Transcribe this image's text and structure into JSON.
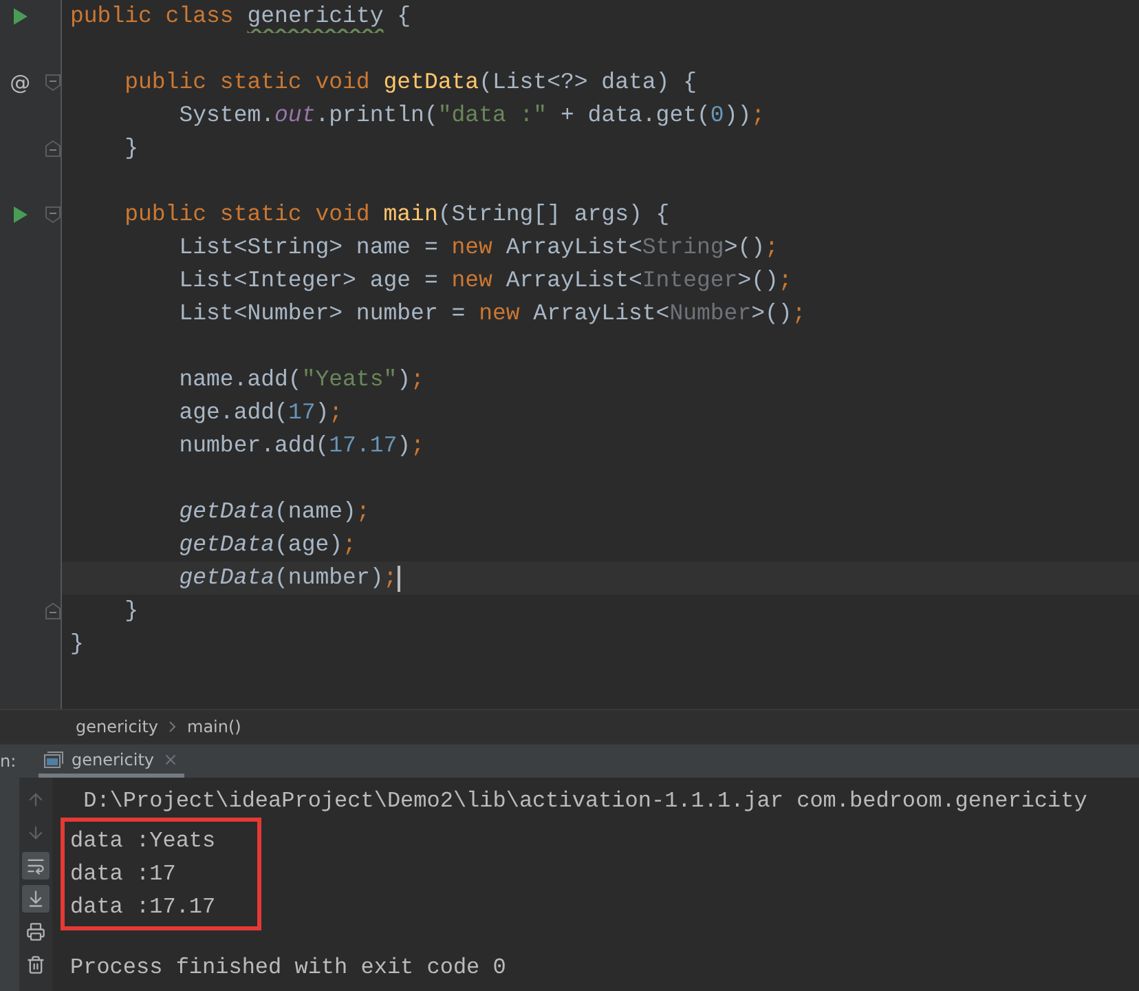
{
  "editor": {
    "lines": [
      {
        "marker": {
          "kind": "run"
        },
        "caret": false,
        "tokens": [
          {
            "kind": "kw",
            "text": "public class "
          },
          {
            "kind": "warn",
            "text": "genericity"
          },
          {
            "kind": "plain",
            "text": " {"
          }
        ]
      },
      {
        "caret": false
      },
      {
        "marker": {
          "kind": "override",
          "text": "@"
        },
        "fold": {
          "kind": "start"
        },
        "caret": false,
        "tokens": [
          {
            "kind": "kw",
            "text": "    public static void "
          },
          {
            "kind": "decl",
            "text": "getData"
          },
          {
            "kind": "plain",
            "text": "(List<?> data) {"
          }
        ]
      },
      {
        "caret": false,
        "tokens": [
          {
            "kind": "plain",
            "text": "        System."
          },
          {
            "kind": "field",
            "text": "out"
          },
          {
            "kind": "plain",
            "text": ".println("
          },
          {
            "kind": "str",
            "text": "\"data :\""
          },
          {
            "kind": "plain",
            "text": " + data.get("
          },
          {
            "kind": "num",
            "text": "0"
          },
          {
            "kind": "plain",
            "text": "))"
          },
          {
            "kind": "semi",
            "text": ";"
          }
        ]
      },
      {
        "fold": {
          "kind": "end"
        },
        "caret": false,
        "tokens": [
          {
            "kind": "plain",
            "text": "    }"
          }
        ]
      },
      {
        "caret": false
      },
      {
        "marker": {
          "kind": "run"
        },
        "fold": {
          "kind": "start"
        },
        "caret": false,
        "tokens": [
          {
            "kind": "kw",
            "text": "    public static void "
          },
          {
            "kind": "decl",
            "text": "main"
          },
          {
            "kind": "plain",
            "text": "(String[] args) {"
          }
        ]
      },
      {
        "caret": false,
        "tokens": [
          {
            "kind": "plain",
            "text": "        List<String> name = "
          },
          {
            "kind": "kw",
            "text": "new "
          },
          {
            "kind": "plain",
            "text": "ArrayList<"
          },
          {
            "kind": "hint",
            "text": "String"
          },
          {
            "kind": "plain",
            "text": ">()"
          },
          {
            "kind": "semi",
            "text": ";"
          }
        ]
      },
      {
        "caret": false,
        "tokens": [
          {
            "kind": "plain",
            "text": "        List<Integer> age = "
          },
          {
            "kind": "kw",
            "text": "new "
          },
          {
            "kind": "plain",
            "text": "ArrayList<"
          },
          {
            "kind": "hint",
            "text": "Integer"
          },
          {
            "kind": "plain",
            "text": ">()"
          },
          {
            "kind": "semi",
            "text": ";"
          }
        ]
      },
      {
        "caret": false,
        "tokens": [
          {
            "kind": "plain",
            "text": "        List<Number> number = "
          },
          {
            "kind": "kw",
            "text": "new "
          },
          {
            "kind": "plain",
            "text": "ArrayList<"
          },
          {
            "kind": "hint",
            "text": "Number"
          },
          {
            "kind": "plain",
            "text": ">()"
          },
          {
            "kind": "semi",
            "text": ";"
          }
        ]
      },
      {
        "caret": false
      },
      {
        "caret": false,
        "tokens": [
          {
            "kind": "plain",
            "text": "        name.add("
          },
          {
            "kind": "str",
            "text": "\"Yeats\""
          },
          {
            "kind": "plain",
            "text": ")"
          },
          {
            "kind": "semi",
            "text": ";"
          }
        ]
      },
      {
        "caret": false,
        "tokens": [
          {
            "kind": "plain",
            "text": "        age.add("
          },
          {
            "kind": "num",
            "text": "17"
          },
          {
            "kind": "plain",
            "text": ")"
          },
          {
            "kind": "semi",
            "text": ";"
          }
        ]
      },
      {
        "caret": false,
        "tokens": [
          {
            "kind": "plain",
            "text": "        number.add("
          },
          {
            "kind": "num",
            "text": "17.17"
          },
          {
            "kind": "plain",
            "text": ")"
          },
          {
            "kind": "semi",
            "text": ";"
          }
        ]
      },
      {
        "caret": false
      },
      {
        "caret": false,
        "tokens": [
          {
            "kind": "call",
            "text": "        getData"
          },
          {
            "kind": "plain",
            "text": "(name)"
          },
          {
            "kind": "semi",
            "text": ";"
          }
        ]
      },
      {
        "caret": false,
        "tokens": [
          {
            "kind": "call",
            "text": "        getData"
          },
          {
            "kind": "plain",
            "text": "(age)"
          },
          {
            "kind": "semi",
            "text": ";"
          }
        ]
      },
      {
        "caret": true,
        "tokens": [
          {
            "kind": "call",
            "text": "        getData"
          },
          {
            "kind": "plain",
            "text": "(number)"
          },
          {
            "kind": "semi",
            "text": ";"
          }
        ]
      },
      {
        "fold": {
          "kind": "end"
        },
        "caret": false,
        "tokens": [
          {
            "kind": "plain",
            "text": "    }"
          }
        ]
      },
      {
        "caret": false,
        "tokens": [
          {
            "kind": "plain",
            "text": "}"
          }
        ]
      },
      {
        "caret": false
      }
    ]
  },
  "breadcrumb": [
    "genericity",
    "main()"
  ],
  "run_panel": {
    "label": "n:",
    "tab": {
      "title": "genericity",
      "selected": true
    },
    "tools": [
      {
        "kind": "up",
        "selected": false
      },
      {
        "kind": "down",
        "selected": false
      },
      {
        "kind": "wrap",
        "selected": true
      },
      {
        "kind": "scroll_end",
        "selected": true
      },
      {
        "kind": "print",
        "selected": false
      },
      {
        "kind": "trash",
        "selected": false
      }
    ],
    "console": {
      "path_line": " D:\\Project\\ideaProject\\Demo2\\lib\\activation-1.1.1.jar com.bedroom.genericity",
      "boxed_output": [
        "data :Yeats",
        "data :17",
        "data :17.17"
      ],
      "exit_message": "Process finished with exit code 0"
    }
  }
}
